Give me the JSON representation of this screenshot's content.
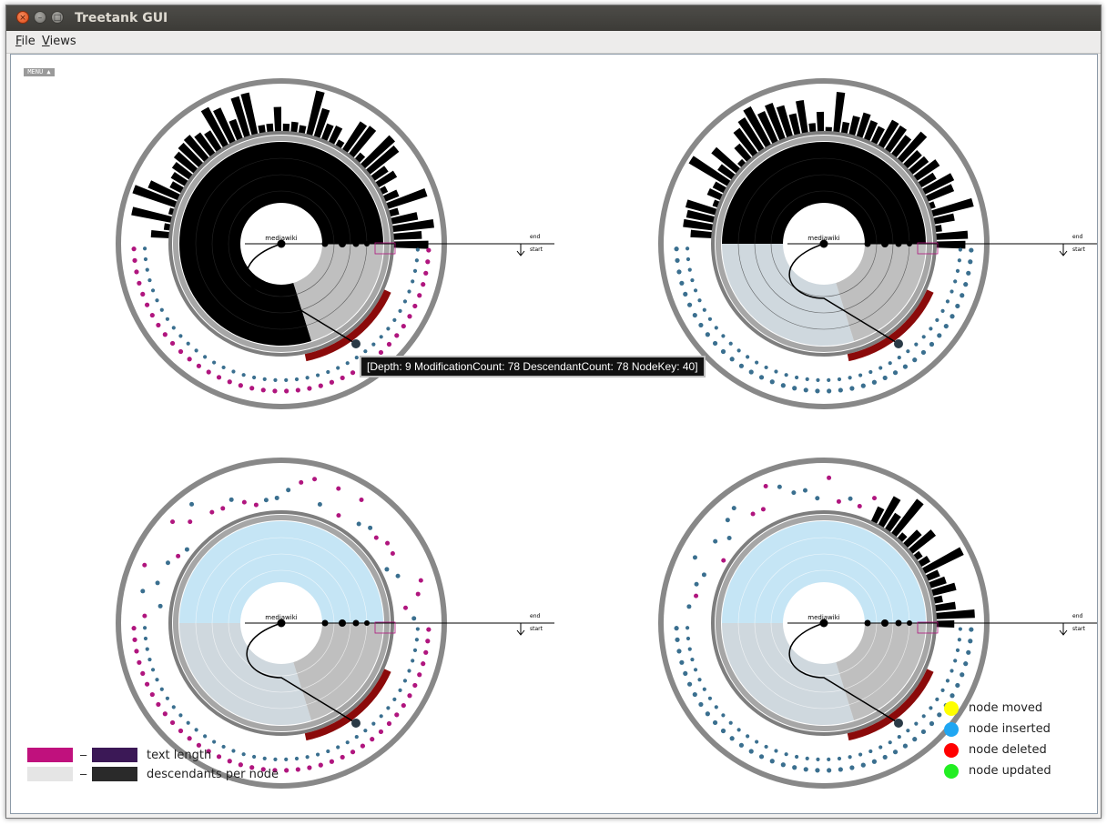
{
  "window": {
    "title": "Treetank GUI",
    "controls": {
      "close": "×",
      "minimize": "–",
      "maximize": "□"
    }
  },
  "menubar": {
    "file": {
      "mnemonic": "F",
      "rest": "ile"
    },
    "views": {
      "mnemonic": "V",
      "rest": "iews"
    }
  },
  "canvas": {
    "menu_tab": "MENU ▲",
    "tooltip": "[Depth: 9 ModificationCount: 78 DescendantCount: 78 NodeKey: 40]",
    "sunburst_labels": {
      "root": "mediawiki",
      "axis_end": "end",
      "axis_start": "start"
    },
    "sunbursts": [
      {
        "id": "top-left",
        "upper_fill": "#000000",
        "upper_ring_mode": "black"
      },
      {
        "id": "top-right",
        "upper_fill": "#000000",
        "upper_ring_mode": "black"
      },
      {
        "id": "bottom-left",
        "upper_fill": "#c5e5f5",
        "upper_ring_mode": "nodes"
      },
      {
        "id": "bottom-right",
        "upper_fill": "#c5e5f5",
        "upper_ring_mode": "mixed"
      }
    ]
  },
  "legend_gradients": [
    {
      "label": "text length",
      "start_color": "#c0117d",
      "end_color": "#3b1856"
    },
    {
      "label": "descendants per node",
      "start_color": "#e5e5e5",
      "end_color": "#2a2a2a"
    }
  ],
  "legend_dash": "–",
  "legend_dots": [
    {
      "label": "node moved",
      "color": "#ffff00"
    },
    {
      "label": "node inserted",
      "color": "#1fa6f2"
    },
    {
      "label": "node deleted",
      "color": "#ff0000"
    },
    {
      "label": "node updated",
      "color": "#22ee22"
    }
  ],
  "colors": {
    "lower_body": "#bfbfbf",
    "lower_band": "#cfd8de",
    "deleted_band": "#8b0a0a",
    "rim": "#888888",
    "node_blue": "#3a6f8f",
    "node_magenta": "#b0157e"
  }
}
